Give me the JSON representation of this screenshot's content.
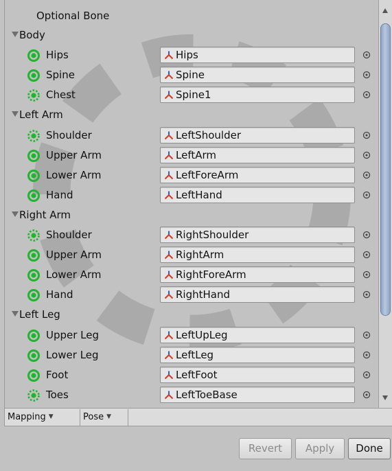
{
  "optional_label": "Optional Bone",
  "groups": [
    {
      "label": "Body",
      "bones": [
        {
          "label": "Hips",
          "value": "Hips",
          "required": true
        },
        {
          "label": "Spine",
          "value": "Spine",
          "required": true
        },
        {
          "label": "Chest",
          "value": "Spine1",
          "required": false
        }
      ]
    },
    {
      "label": "Left Arm",
      "bones": [
        {
          "label": "Shoulder",
          "value": "LeftShoulder",
          "required": false
        },
        {
          "label": "Upper Arm",
          "value": "LeftArm",
          "required": true
        },
        {
          "label": "Lower Arm",
          "value": "LeftForeArm",
          "required": true
        },
        {
          "label": "Hand",
          "value": "LeftHand",
          "required": true
        }
      ]
    },
    {
      "label": "Right Arm",
      "bones": [
        {
          "label": "Shoulder",
          "value": "RightShoulder",
          "required": false
        },
        {
          "label": "Upper Arm",
          "value": "RightArm",
          "required": true
        },
        {
          "label": "Lower Arm",
          "value": "RightForeArm",
          "required": true
        },
        {
          "label": "Hand",
          "value": "RightHand",
          "required": true
        }
      ]
    },
    {
      "label": "Left Leg",
      "bones": [
        {
          "label": "Upper Leg",
          "value": "LeftUpLeg",
          "required": true
        },
        {
          "label": "Lower Leg",
          "value": "LeftLeg",
          "required": true
        },
        {
          "label": "Foot",
          "value": "LeftFoot",
          "required": true
        },
        {
          "label": "Toes",
          "value": "LeftToeBase",
          "required": false
        }
      ]
    }
  ],
  "toolbar": {
    "mapping_label": "Mapping",
    "pose_label": "Pose"
  },
  "buttons": {
    "revert": "Revert",
    "apply": "Apply",
    "done": "Done"
  },
  "colors": {
    "bone_green": "#1fb52e",
    "optional_dots": "#aaaaaa",
    "scroll_thumb": "#a5b8d3"
  },
  "icons": {
    "required_bone": "green-ring-dot-icon",
    "optional_bone": "dotted-ring-icon",
    "transform": "transform-axes-icon",
    "object_picker": "object-picker-icon"
  }
}
